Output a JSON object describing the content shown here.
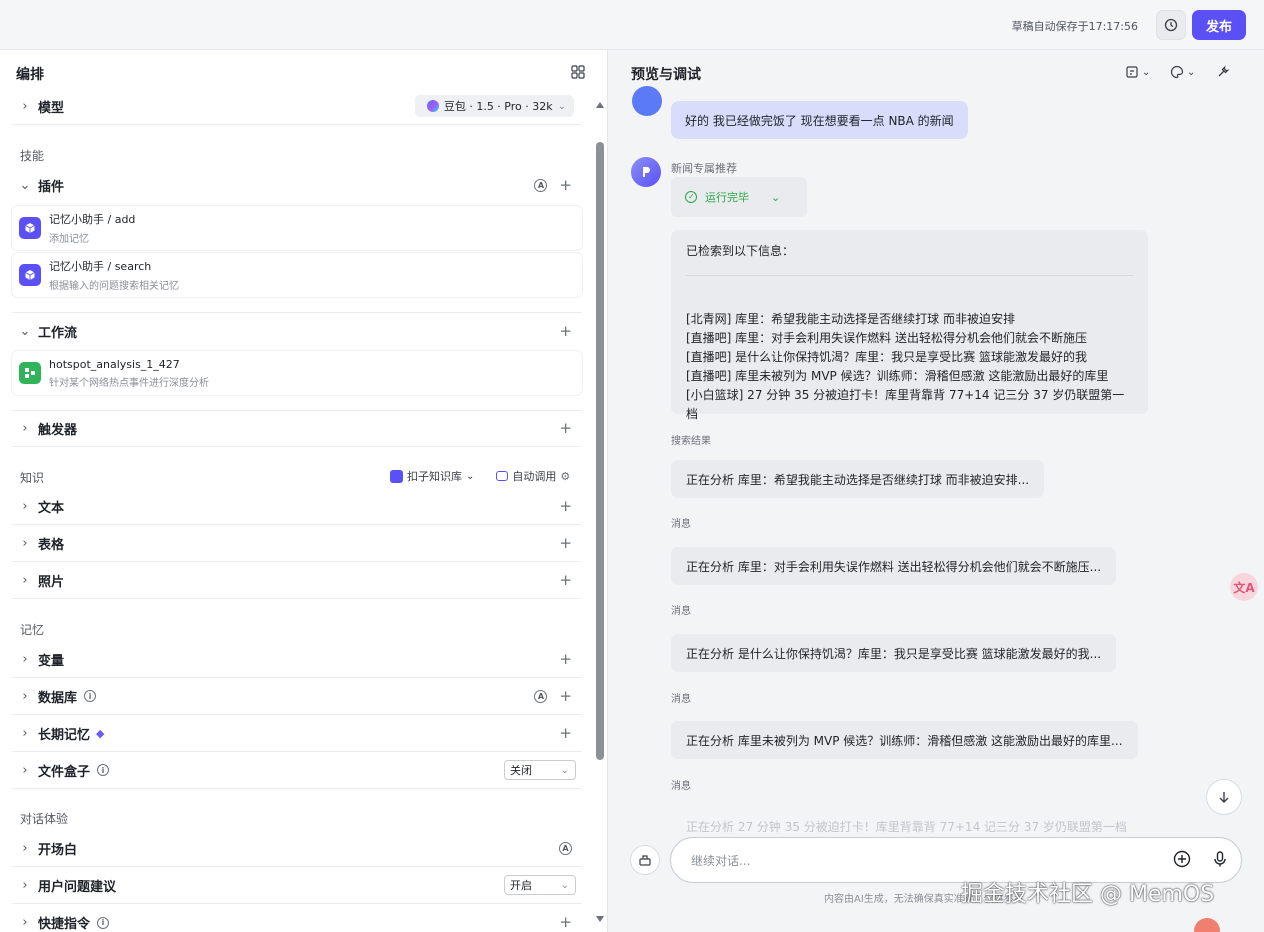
{
  "topbar": {
    "saved_text": "草稿自动保存于17:17:56",
    "publish_label": "发布"
  },
  "left": {
    "title": "编排",
    "model": {
      "label": "模型",
      "value": "豆包 · 1.5 · Pro · 32k"
    },
    "skills": {
      "section": "技能",
      "plugins_label": "插件",
      "plugin_items": [
        {
          "name": "记忆小助手 / add",
          "desc": "添加记忆"
        },
        {
          "name": "记忆小助手 / search",
          "desc": "根据输入的问题搜索相关记忆"
        }
      ],
      "workflow_label": "工作流",
      "workflow_items": [
        {
          "name": "hotspot_analysis_1_427",
          "desc": "针对某个网络热点事件进行深度分析"
        }
      ],
      "trigger_label": "触发器"
    },
    "knowledge": {
      "section": "知识",
      "kb_label": "扣子知识库",
      "auto_label": "自动调用",
      "items": [
        "文本",
        "表格",
        "照片"
      ]
    },
    "memory": {
      "section": "记忆",
      "variable": "变量",
      "database": "数据库",
      "long_term": "长期记忆",
      "filebox": "文件盒子",
      "filebox_value": "关闭"
    },
    "dialog": {
      "section": "对话体验",
      "opening": "开场白",
      "suggestions": "用户问题建议",
      "suggestions_value": "开启",
      "shortcuts": "快捷指令"
    }
  },
  "right": {
    "title": "预览与调试",
    "user_message": "好的 我已经做完饭了 现在想要看一点 NBA 的新闻",
    "bot_name": "新闻专属推荐",
    "run_status": "运行完毕",
    "result_intro": "已检索到以下信息：",
    "result_lines": [
      "[北青网] 库里：希望我能主动选择是否继续打球 而非被迫安排",
      "[直播吧] 库里：对手会利用失误作燃料 送出轻松得分机会他们就会不断施压",
      "[直播吧] 是什么让你保持饥渴？库里：我只是享受比赛 篮球能激发最好的我",
      "[直播吧] 库里未被列为 MVP 候选？训练师：滑稽但感激 这能激励出最好的库里",
      "[小白篮球] 27 分钟 35 分被迫打卡！库里背靠背 77+14 记三分 37 岁仍联盟第一档"
    ],
    "search_label": "搜索结果",
    "msg_label": "消息",
    "analysis": [
      "正在分析 库里：希望我能主动选择是否继续打球 而非被迫安排...",
      "正在分析 库里：对手会利用失误作燃料 送出轻松得分机会他们就会不断施压...",
      "正在分析 是什么让你保持饥渴？库里：我只是享受比赛 篮球能激发最好的我...",
      "正在分析 库里未被列为 MVP 候选？训练师：滑稽但感激 这能激励出最好的库里..."
    ],
    "faded_text": "正在分析 27 分钟 35 分被迫打卡！库里背靠背 77+14 记三分 37 岁仍联盟第一档",
    "input_placeholder": "继续对话...",
    "disclaimer": "内容由AI生成，无法确保真实准确，仅供参考",
    "watermark": "掘金技术社区 @ MemOS",
    "translate_label": "文A"
  }
}
